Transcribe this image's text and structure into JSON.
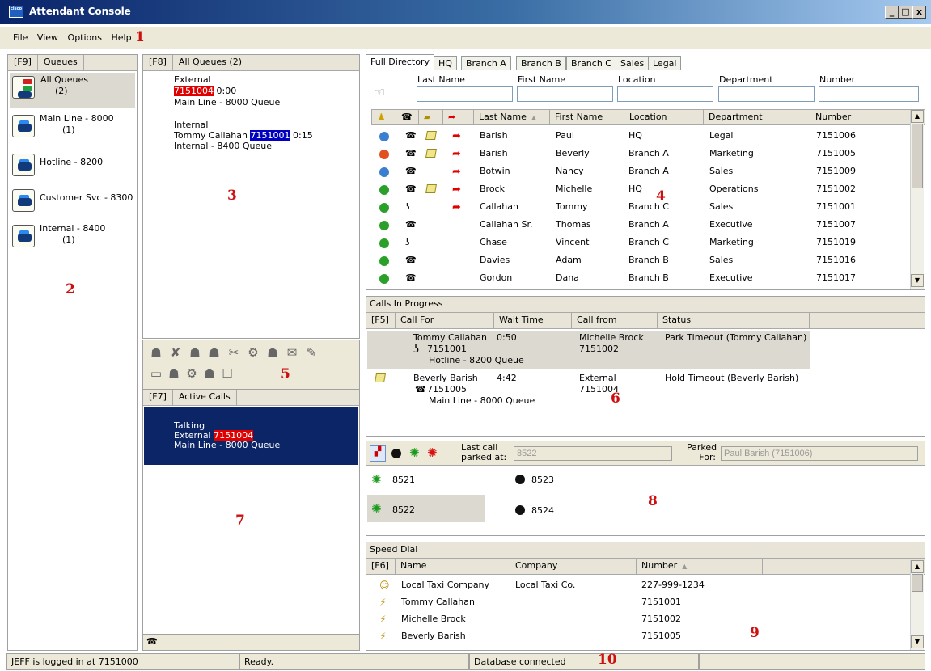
{
  "window": {
    "title": "Attendant Console",
    "app_icon": "cisco-logo-icon",
    "buttons": [
      "_",
      "□",
      "x"
    ]
  },
  "menu": {
    "items": [
      "File",
      "View",
      "Options",
      "Help"
    ]
  },
  "annotations": [
    "1",
    "2",
    "3",
    "4",
    "5",
    "6",
    "7",
    "8",
    "9",
    "10"
  ],
  "queues_panel": {
    "key": "[F9]",
    "title": "Queues",
    "items": [
      {
        "name": "All Queues",
        "count": "(2)",
        "icon": "all-queues-icon"
      },
      {
        "name": "Main Line - 8000",
        "count": "(1)",
        "icon": "queue-phone-icon"
      },
      {
        "name": "Hotline - 8200",
        "count": "",
        "icon": "queue-phone-icon"
      },
      {
        "name": "Customer Svc - 8300",
        "count": "",
        "icon": "queue-phone-icon"
      },
      {
        "name": "Internal - 8400",
        "count": "(1)",
        "icon": "queue-phone-icon"
      }
    ]
  },
  "queue_calls": {
    "key": "[F8]",
    "title": "All Queues (2)",
    "external": {
      "label": "External",
      "number": "7151004",
      "time": "0:00",
      "queue": "Main Line - 8000 Queue"
    },
    "internal": {
      "label": "Internal",
      "caller": "Tommy Callahan",
      "number": "7151001",
      "time": "0:15",
      "queue": "Internal - 8400 Queue"
    }
  },
  "toolbar": {
    "icons": [
      "answer-icon",
      "release-icon",
      "hold-icon",
      "transfer-icon",
      "consult-transfer-icon",
      "conference-icon",
      "park-icon",
      "dial-icon",
      "blind-transfer-icon",
      "display-icon",
      "phone-hold-icon",
      "join-icon",
      "voicemail-icon",
      "redirect-icon"
    ]
  },
  "active_calls": {
    "key": "[F7]",
    "title": "Active Calls",
    "call": {
      "state": "Talking",
      "label": "External",
      "number": "7151004",
      "queue": "Main Line - 8000 Queue"
    },
    "footer_icon": "phone-icon"
  },
  "directory": {
    "tabs": [
      "Full Directory",
      "HQ",
      "Branch A",
      "Branch B",
      "Branch C",
      "Sales",
      "Legal"
    ],
    "search_labels": [
      "Last Name",
      "First Name",
      "Location",
      "Department",
      "Number"
    ],
    "columns": [
      "Last Name",
      "First Name",
      "Location",
      "Department",
      "Number"
    ],
    "rows": [
      {
        "status": "#3a7fd0",
        "status_icon": "away-icon",
        "phone": "desk-phone-icon",
        "note": true,
        "forward": true,
        "last": "Barish",
        "first": "Paul",
        "location": "HQ",
        "department": "Legal",
        "number": "7151006"
      },
      {
        "status": "#e05020",
        "status_icon": "busy-icon",
        "phone": "desk-phone-icon",
        "note": true,
        "forward": true,
        "last": "Barish",
        "first": "Beverly",
        "location": "Branch A",
        "department": "Marketing",
        "number": "7151005"
      },
      {
        "status": "#3a7fd0",
        "status_icon": "dnd-icon",
        "phone": "desk-phone-icon",
        "note": false,
        "forward": true,
        "last": "Botwin",
        "first": "Nancy",
        "location": "Branch A",
        "department": "Sales",
        "number": "7151009"
      },
      {
        "status": "#2aa02a",
        "status_icon": "available-icon",
        "phone": "desk-phone-icon",
        "note": true,
        "forward": true,
        "last": "Brock",
        "first": "Michelle",
        "location": "HQ",
        "department": "Operations",
        "number": "7151002"
      },
      {
        "status": "#2aa02a",
        "status_icon": "available-icon",
        "phone": "offhook-phone-icon",
        "note": false,
        "forward": true,
        "last": "Callahan",
        "first": "Tommy",
        "location": "Branch C",
        "department": "Sales",
        "number": "7151001"
      },
      {
        "status": "#2aa02a",
        "status_icon": "available-icon",
        "phone": "desk-phone-icon",
        "note": false,
        "forward": false,
        "last": "Callahan Sr.",
        "first": "Thomas",
        "location": "Branch A",
        "department": "Executive",
        "number": "7151007"
      },
      {
        "status": "#2aa02a",
        "status_icon": "available-icon",
        "phone": "offhook-phone-icon",
        "note": false,
        "forward": false,
        "last": "Chase",
        "first": "Vincent",
        "location": "Branch C",
        "department": "Marketing",
        "number": "7151019"
      },
      {
        "status": "#2aa02a",
        "status_icon": "available-icon",
        "phone": "desk-phone-icon",
        "note": false,
        "forward": false,
        "last": "Davies",
        "first": "Adam",
        "location": "Branch B",
        "department": "Sales",
        "number": "7151016"
      },
      {
        "status": "#2aa02a",
        "status_icon": "available-icon",
        "phone": "desk-phone-icon",
        "note": false,
        "forward": false,
        "last": "Gordon",
        "first": "Dana",
        "location": "Branch B",
        "department": "Executive",
        "number": "7151017"
      }
    ]
  },
  "calls_in_progress": {
    "title": "Calls In Progress",
    "key": "[F5]",
    "columns": [
      "Call For",
      "Wait Time",
      "Call from",
      "Status"
    ],
    "rows": [
      {
        "call_for": "Tommy Callahan",
        "number": "7151001",
        "queue": "Hotline - 8200 Queue",
        "wait": "0:50",
        "from_name": "Michelle Brock",
        "from_number": "7151002",
        "status": "Park Timeout (Tommy Callahan)"
      },
      {
        "call_for": "Beverly Barish",
        "number": "7151005",
        "queue": "Main Line - 8000 Queue",
        "wait": "4:42",
        "from_name": "External",
        "from_number": "7151004",
        "status": "Hold Timeout (Beverly Barish)"
      }
    ]
  },
  "park": {
    "last_label": "Last call parked at:",
    "last_value": "8522",
    "parked_label": "Parked For:",
    "parked_value": "Paul Barish (7151006)",
    "slots": [
      "8521",
      "8523",
      "8522",
      "8524"
    ]
  },
  "speed_dial": {
    "title": "Speed Dial",
    "key": "[F6]",
    "columns": [
      "Name",
      "Company",
      "Number"
    ],
    "rows": [
      {
        "icon": "contact-card-icon",
        "name": "Local Taxi Company",
        "company": "Local Taxi Co.",
        "number": "227-999-1234"
      },
      {
        "icon": "speed-dial-icon",
        "name": "Tommy Callahan",
        "company": "",
        "number": "7151001"
      },
      {
        "icon": "speed-dial-icon",
        "name": "Michelle Brock",
        "company": "",
        "number": "7151002"
      },
      {
        "icon": "speed-dial-icon",
        "name": "Beverly Barish",
        "company": "",
        "number": "7151005"
      }
    ]
  },
  "status_bar": {
    "login": "JEFF is logged in at 7151000",
    "state": "Ready.",
    "db": "Database connected"
  }
}
